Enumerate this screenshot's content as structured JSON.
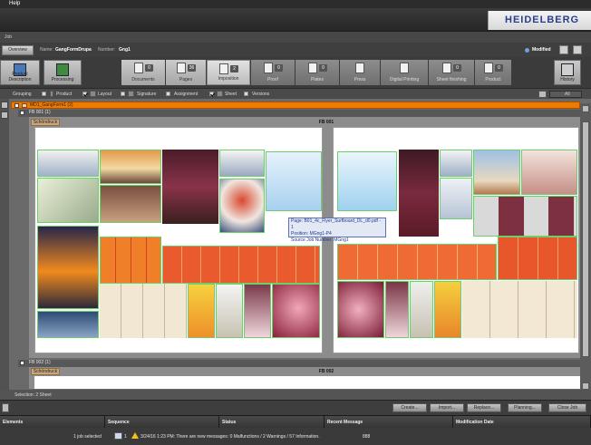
{
  "menu": {
    "help": "Help"
  },
  "brand": {
    "logo": "HEIDELBERG"
  },
  "jobbar": {
    "label": "Job"
  },
  "info": {
    "overview": "Overview",
    "name_label": "Name:",
    "name_value": "GangFormDrupa",
    "number_label": "Number:",
    "number_value": "Gng1",
    "modified": "Modified"
  },
  "workflow": {
    "product_description": "Product Description",
    "processing": "Processing",
    "steps": [
      {
        "label": "Documents",
        "count": "0"
      },
      {
        "label": "Pages",
        "count": "36"
      },
      {
        "label": "Imposition",
        "count": "2"
      },
      {
        "label": "Proof",
        "count": "0"
      },
      {
        "label": "Plates",
        "count": "0"
      },
      {
        "label": "Press",
        "count": ""
      },
      {
        "label": "Digital Printing",
        "count": ""
      },
      {
        "label": "Sheet finishing",
        "count": "0"
      },
      {
        "label": "Product",
        "count": "0"
      }
    ],
    "history": "History"
  },
  "grouping": {
    "label": "Grouping",
    "product": "Product",
    "layout": "Layout",
    "signature": "Signature",
    "assignment": "Assignment",
    "sheet": "Sheet",
    "versions": "Versions",
    "filter": "All",
    "product_checked": false,
    "layout_checked": true,
    "signature_checked": false,
    "assignment_checked": false,
    "sheet_checked": true,
    "versions_checked": false
  },
  "tree": {
    "gang": "MD1_GangForm1 (2)",
    "fb1": "FB 001 (1)",
    "fb1_tag": "Schöndruck",
    "fb1_title": "FB 001",
    "fb2": "FB 002 (1)",
    "fb2_tag": "Schöndruck",
    "fb2_title": "FB 002"
  },
  "tooltip": {
    "line1": "Page: B01_4c_Flyer_Surfboard_DL_d0.pdf - 1",
    "line2": "Position: MGng1-P4",
    "line3": "Source Job Number: MGng1"
  },
  "selection": {
    "text": "Selection:  2 Sheet"
  },
  "actions": {
    "create": "Create...",
    "import": "Import...",
    "replace": "Replace...",
    "planning": "Planning...",
    "close_job": "Close Job"
  },
  "columns": {
    "elements": "Elements",
    "sequence": "Sequence",
    "status": "Status",
    "recent_message": "Recent Message",
    "modification_date": "Modification Date"
  },
  "status": {
    "selected": "1 job selected",
    "count": "1",
    "message": "3/24/16 1:23 PM: There are new messages: 0 Malfunctions / 2 Warnings / 57 Information.",
    "code": "888"
  }
}
